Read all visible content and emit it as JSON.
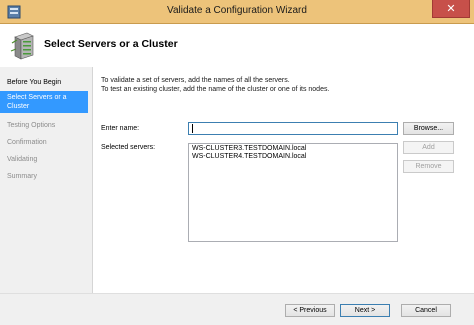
{
  "window": {
    "title": "Validate a Configuration Wizard",
    "close_glyph": "✕",
    "app_icon": "wizard-app-icon",
    "accent_color": "#edc37a"
  },
  "header": {
    "title": "Select Servers or a Cluster",
    "icon": "servers-icon"
  },
  "sidebar": {
    "items": [
      {
        "label": "Before You Begin",
        "state": "completed"
      },
      {
        "label": "Select Servers or a Cluster",
        "state": "active"
      },
      {
        "label": "Testing Options",
        "state": "pending"
      },
      {
        "label": "Confirmation",
        "state": "pending"
      },
      {
        "label": "Validating",
        "state": "pending"
      },
      {
        "label": "Summary",
        "state": "pending"
      }
    ]
  },
  "main": {
    "instruction_line1": "To validate a set of servers, add the names of all the servers.",
    "instruction_line2": "To test an existing cluster, add the name of the cluster or one of its nodes.",
    "enter_name_label": "Enter name:",
    "enter_name_value": "",
    "selected_servers_label": "Selected servers:",
    "selected_servers": [
      "WS-CLUSTER3.TESTDOMAIN.local",
      "WS-CLUSTER4.TESTDOMAIN.local"
    ],
    "browse_label": "Browse...",
    "add_label": "Add",
    "remove_label": "Remove"
  },
  "footer": {
    "previous_label": "< Previous",
    "next_label": "Next >",
    "cancel_label": "Cancel"
  }
}
